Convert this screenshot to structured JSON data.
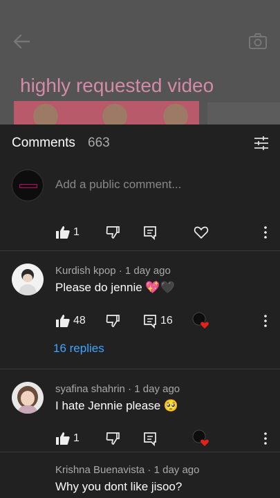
{
  "video": {
    "title": "highly requested video",
    "back_icon": "arrow-left-icon",
    "camera_icon": "camera-icon"
  },
  "comments_panel": {
    "title": "Comments",
    "count": "663",
    "add_placeholder": "Add a public comment..."
  },
  "first_actions": {
    "like_count": "1"
  },
  "comments": [
    {
      "author": "Kurdish kpop",
      "time": "1 day ago",
      "text": "Please do jennie 💖🖤",
      "likes": "48",
      "reply_count": "16",
      "replies_link": "16 replies"
    },
    {
      "author": "syafina shahrin",
      "time": "1 day ago",
      "text": "I hate Jennie please 🥺",
      "likes": "1"
    },
    {
      "author": "Krishna Buenavista",
      "time": "1 day ago",
      "text": "Why you dont like jisoo?"
    }
  ],
  "colors": {
    "background": "#212121",
    "link": "#3ea6ff",
    "heart": "#e62117",
    "title_pink": "#d48aa8"
  }
}
